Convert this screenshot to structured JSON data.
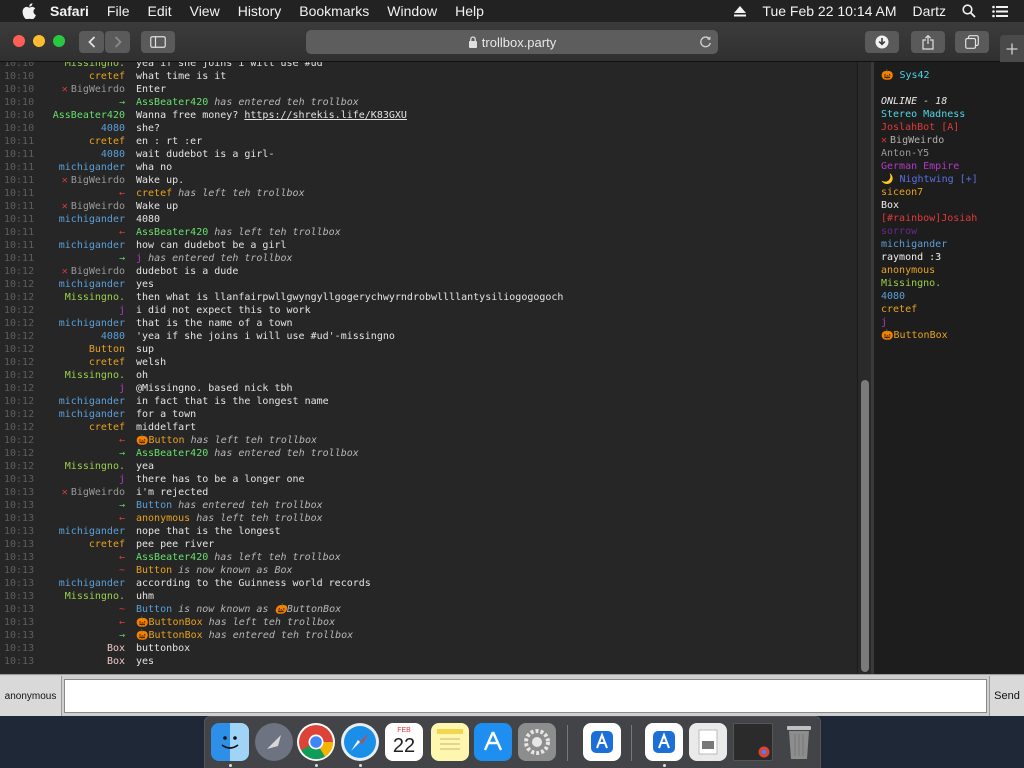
{
  "menubar": {
    "items": [
      "Safari",
      "File",
      "Edit",
      "View",
      "History",
      "Bookmarks",
      "Window",
      "Help"
    ],
    "datetime": "Tue Feb 22  10:14 AM",
    "user": "Dartz"
  },
  "browser": {
    "url": "trollbox.party"
  },
  "colors": {
    "green": "#66e06a",
    "orange": "#e8a21e",
    "blue": "#5a9fd8",
    "lime": "#9ad04a",
    "purple": "#b03ac8",
    "red": "#e03a3a",
    "grey": "#b0b0b0",
    "cyan": "#4fd6e6"
  },
  "chat": [
    {
      "time": "10:10",
      "nick": "Missingno.",
      "nick_color": "#9ad04a",
      "text": "yea if she joins i will use #ud"
    },
    {
      "time": "10:10",
      "nick": "cretef",
      "nick_color": "#e8a21e",
      "text": "what time is it"
    },
    {
      "time": "10:10",
      "nick": "BigWeirdo",
      "nick_color": "#9a9a9a",
      "x": true,
      "text": "Enter"
    },
    {
      "time": "10:10",
      "nick": "→",
      "nick_color": "#5fd35f",
      "event": true,
      "subject": "AssBeater420",
      "subject_color": "#66e06a",
      "text": "has entered teh trollbox"
    },
    {
      "time": "10:10",
      "nick": "AssBeater420",
      "nick_color": "#66e06a",
      "text": "Wanna free money? ",
      "link": "https://shrekis.life/K83GXU"
    },
    {
      "time": "10:10",
      "nick": "4080",
      "nick_color": "#5a9fd8",
      "text": "she?"
    },
    {
      "time": "10:11",
      "nick": "cretef",
      "nick_color": "#e8a21e",
      "text": "en : rt :er"
    },
    {
      "time": "10:11",
      "nick": "4080",
      "nick_color": "#5a9fd8",
      "text": "wait dudebot is a girl-"
    },
    {
      "time": "10:11",
      "nick": "michigander",
      "nick_color": "#5a9fd8",
      "text": "wha no"
    },
    {
      "time": "10:11",
      "nick": "BigWeirdo",
      "nick_color": "#9a9a9a",
      "x": true,
      "text": "Wake up."
    },
    {
      "time": "10:11",
      "nick": "←",
      "nick_color": "#e03a3a",
      "event": true,
      "subject": "cretef",
      "subject_color": "#e8a21e",
      "text": "has left teh trollbox"
    },
    {
      "time": "10:11",
      "nick": "BigWeirdo",
      "nick_color": "#9a9a9a",
      "x": true,
      "text": "Wake up"
    },
    {
      "time": "10:11",
      "nick": "michigander",
      "nick_color": "#5a9fd8",
      "text": "4080"
    },
    {
      "time": "10:11",
      "nick": "←",
      "nick_color": "#e03a3a",
      "event": true,
      "subject": "AssBeater420",
      "subject_color": "#66e06a",
      "text": "has left teh trollbox"
    },
    {
      "time": "10:11",
      "nick": "michigander",
      "nick_color": "#5a9fd8",
      "text": "how can dudebot be a girl"
    },
    {
      "time": "10:11",
      "nick": "→",
      "nick_color": "#5fd35f",
      "event": true,
      "subject": "j",
      "subject_color": "#b03ac8",
      "text": "has entered teh trollbox"
    },
    {
      "time": "10:12",
      "nick": "BigWeirdo",
      "nick_color": "#9a9a9a",
      "x": true,
      "text": "dudebot is a dude"
    },
    {
      "time": "10:12",
      "nick": "michigander",
      "nick_color": "#5a9fd8",
      "text": "yes"
    },
    {
      "time": "10:12",
      "nick": "Missingno.",
      "nick_color": "#9ad04a",
      "text": "then what is llanfairpwllgwyngyllgogerychwyrndrobwllllantysiliogogogoch"
    },
    {
      "time": "10:12",
      "nick": "j",
      "nick_color": "#b03ac8",
      "text": "i did not expect this to work"
    },
    {
      "time": "10:12",
      "nick": "michigander",
      "nick_color": "#5a9fd8",
      "text": "that is the name of a town"
    },
    {
      "time": "10:12",
      "nick": "4080",
      "nick_color": "#5a9fd8",
      "text": "'yea if she joins i will use #ud'-missingno"
    },
    {
      "time": "10:12",
      "nick": "Button",
      "nick_color": "#e8a21e",
      "text": "sup"
    },
    {
      "time": "10:12",
      "nick": "cretef",
      "nick_color": "#e8a21e",
      "text": "welsh"
    },
    {
      "time": "10:12",
      "nick": "Missingno.",
      "nick_color": "#9ad04a",
      "text": "oh"
    },
    {
      "time": "10:12",
      "nick": "j",
      "nick_color": "#b03ac8",
      "text": "@Missingno. based nick tbh"
    },
    {
      "time": "10:12",
      "nick": "michigander",
      "nick_color": "#5a9fd8",
      "text": "in fact that is the longest name"
    },
    {
      "time": "10:12",
      "nick": "michigander",
      "nick_color": "#5a9fd8",
      "text": "for a town"
    },
    {
      "time": "10:12",
      "nick": "cretef",
      "nick_color": "#e8a21e",
      "text": "middelfart"
    },
    {
      "time": "10:12",
      "nick": "←",
      "nick_color": "#e03a3a",
      "event": true,
      "subject": "🎃Button",
      "subject_color": "#e8a21e",
      "text": "has left teh trollbox"
    },
    {
      "time": "10:12",
      "nick": "→",
      "nick_color": "#5fd35f",
      "event": true,
      "subject": "AssBeater420",
      "subject_color": "#66e06a",
      "text": "has entered teh trollbox"
    },
    {
      "time": "10:12",
      "nick": "Missingno.",
      "nick_color": "#9ad04a",
      "text": "yea"
    },
    {
      "time": "10:13",
      "nick": "j",
      "nick_color": "#b03ac8",
      "text": "there has to be a longer one"
    },
    {
      "time": "10:13",
      "nick": "BigWeirdo",
      "nick_color": "#9a9a9a",
      "x": true,
      "text": "i'm rejected"
    },
    {
      "time": "10:13",
      "nick": "→",
      "nick_color": "#5fd35f",
      "event": true,
      "subject": "Button",
      "subject_color": "#5a9fd8",
      "text": "has entered teh trollbox"
    },
    {
      "time": "10:13",
      "nick": "←",
      "nick_color": "#e03a3a",
      "event": true,
      "subject": "anonymous",
      "subject_color": "#e8a21e",
      "text": "has left teh trollbox"
    },
    {
      "time": "10:13",
      "nick": "michigander",
      "nick_color": "#5a9fd8",
      "text": "nope that is the longest"
    },
    {
      "time": "10:13",
      "nick": "cretef",
      "nick_color": "#e8a21e",
      "text": "pee pee river"
    },
    {
      "time": "10:13",
      "nick": "←",
      "nick_color": "#e03a3a",
      "event": true,
      "subject": "AssBeater420",
      "subject_color": "#66e06a",
      "text": "has left teh trollbox"
    },
    {
      "time": "10:13",
      "nick": "~",
      "nick_color": "#e03a3a",
      "event": true,
      "subject": "Button",
      "subject_color": "#e8a21e",
      "text": "is now known as Box"
    },
    {
      "time": "10:13",
      "nick": "michigander",
      "nick_color": "#5a9fd8",
      "text": "according to the Guinness world records"
    },
    {
      "time": "10:13",
      "nick": "Missingno.",
      "nick_color": "#9ad04a",
      "text": "uhm"
    },
    {
      "time": "10:13",
      "nick": "~",
      "nick_color": "#e03a3a",
      "event": true,
      "subject": "Button",
      "subject_color": "#5a9fd8",
      "text": "is now known as 🎃ButtonBox"
    },
    {
      "time": "10:13",
      "nick": "←",
      "nick_color": "#e03a3a",
      "event": true,
      "subject": "🎃ButtonBox",
      "subject_color": "#e8a21e",
      "text": "has left teh trollbox"
    },
    {
      "time": "10:13",
      "nick": "→",
      "nick_color": "#5fd35f",
      "event": true,
      "subject": "🎃ButtonBox",
      "subject_color": "#e8a21e",
      "text": "has entered teh trollbox"
    },
    {
      "time": "10:13",
      "nick": "Box",
      "nick_color": "#f0c8c8",
      "text": "buttonbox"
    },
    {
      "time": "10:13",
      "nick": "Box",
      "nick_color": "#f0c8c8",
      "text": "yes"
    }
  ],
  "userlist": {
    "header_user": "🎃 Sys42",
    "online_label": "ONLINE - 18",
    "users": [
      {
        "name": "Stereo Madness",
        "color": "#4fd6e6"
      },
      {
        "name": "JoslahBot [A]",
        "color": "#e03a3a"
      },
      {
        "name": "BigWeirdo",
        "color": "#b0b0b0",
        "x": true
      },
      {
        "name": "Anton-Y5",
        "color": "#9a9a9a"
      },
      {
        "name": "German Empire",
        "color": "#b03ac8"
      },
      {
        "name": "🌙 Nightwing [+]",
        "color": "#5a6fe0"
      },
      {
        "name": "siceon7",
        "color": "#e8a21e"
      },
      {
        "name": "Box",
        "color": "#f0f0f0"
      },
      {
        "name": "[#rainbow]Josiah",
        "color": "#e03a3a"
      },
      {
        "name": "sorrow",
        "color": "#6a2a8a"
      },
      {
        "name": "michigander",
        "color": "#5a9fd8"
      },
      {
        "name": "raymond :3",
        "color": "#f0f0f0"
      },
      {
        "name": "anonymous",
        "color": "#e8a21e"
      },
      {
        "name": "Missingno.",
        "color": "#9ad04a"
      },
      {
        "name": "4080",
        "color": "#5a9fd8"
      },
      {
        "name": "cretef",
        "color": "#e8a21e"
      },
      {
        "name": "j",
        "color": "#b03ac8"
      },
      {
        "name": "🎃ButtonBox",
        "color": "#e8a21e"
      }
    ]
  },
  "inputbar": {
    "nick": "anonymous",
    "message_value": "",
    "send_label": "Send"
  },
  "dock": {
    "apps": [
      "finder-icon",
      "launchpad-icon",
      "chrome-icon",
      "safari-icon",
      "calendar-icon",
      "notes-icon",
      "app-store-icon",
      "system-preferences-icon",
      "xcode-icon",
      "xcode-icon",
      "preview-icon",
      "chrome-window-icon",
      "trash-icon"
    ],
    "calendar": {
      "month": "FEB",
      "day": "22"
    }
  }
}
